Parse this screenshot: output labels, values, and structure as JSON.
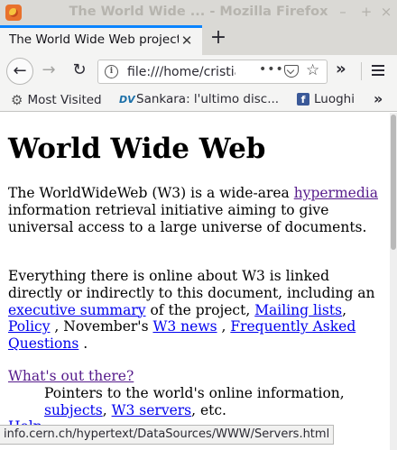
{
  "window": {
    "title": "The World Wide ... - Mozilla Firefox",
    "minimize_icon": "minimize-icon",
    "maximize_icon": "maximize-icon",
    "close_icon": "close-icon"
  },
  "tabs": [
    {
      "title": "The World Wide Web project",
      "active": true,
      "close_glyph": "✕"
    }
  ],
  "new_tab_glyph": "+",
  "nav": {
    "back_glyph": "←",
    "forward_glyph": "→",
    "reload_glyph": "↻",
    "url": "file:///home/cristiano/",
    "page_actions_glyph": "•••",
    "star_glyph": "☆",
    "overflow_glyph": "»"
  },
  "bookmarks": {
    "items": [
      {
        "label": "Most Visited",
        "icon": "gear-icon"
      },
      {
        "label": "Sankara: l'ultimo disc...",
        "icon": "dv-icon",
        "icon_text": "DV"
      },
      {
        "label": "Luoghi",
        "icon": "facebook-icon",
        "icon_text": "f"
      }
    ],
    "overflow_glyph": "»"
  },
  "page": {
    "heading": "World Wide Web",
    "para1": {
      "t1": "The WorldWideWeb (W3) is a wide-area",
      "link_hypermedia": "hypermedia ",
      "t2": "information retrieval initiative aiming to give universal access to a large universe of documents."
    },
    "para2": {
      "t1": "Everything there is online about W3 is linked directly or indirectly to this document, including an ",
      "link_summary": "executive summary",
      "t2": " of the project, ",
      "link_mailing": "Mailing lists",
      "t3": ", ",
      "link_policy": "Policy",
      "t4": " , November's ",
      "link_news": "W3 news",
      "t5": " , ",
      "link_faq": "Frequently Asked Questions",
      "t6": " ."
    },
    "whats_out": {
      "link": "What's out there?",
      "t1": "Pointers to the world's online information, ",
      "link_subjects": "subjects",
      "t2": ", ",
      "link_servers": "W3 servers",
      "t3": ", etc."
    },
    "help_link": "Help"
  },
  "status_url": "info.cern.ch/hypertext/DataSources/WWW/Servers.html",
  "colors": {
    "link": "#0000ee",
    "visited": "#551a8b",
    "tab_accent": "#0a84ff"
  }
}
